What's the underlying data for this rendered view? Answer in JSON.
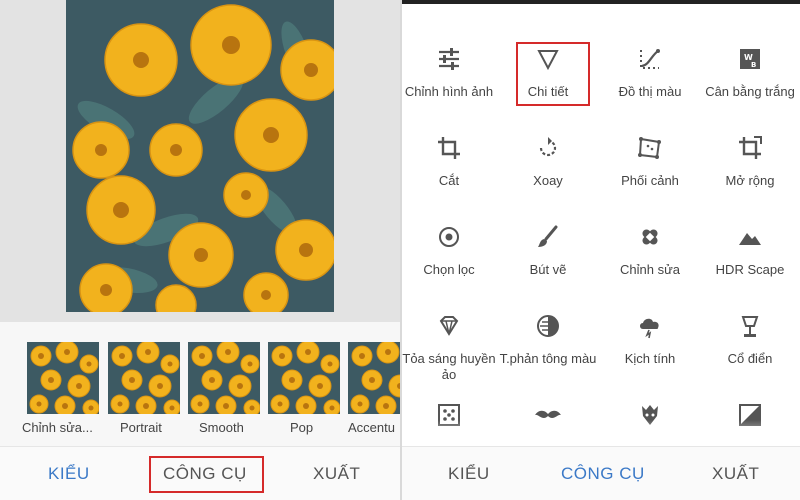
{
  "left_panel": {
    "thumbnails": [
      {
        "label": "Chỉnh sửa..."
      },
      {
        "label": "Portrait"
      },
      {
        "label": "Smooth"
      },
      {
        "label": "Pop"
      },
      {
        "label": "Accentu"
      }
    ],
    "bottom_tabs": {
      "styles": "KIỂU",
      "tools": "CÔNG CỤ",
      "export": "XUẤT"
    }
  },
  "right_panel": {
    "tools": [
      {
        "label": "Chỉnh hình ảnh",
        "icon": "tune-sliders-icon"
      },
      {
        "label": "Chi tiết",
        "icon": "triangle-details-icon"
      },
      {
        "label": "Đồ thị màu",
        "icon": "curves-icon"
      },
      {
        "label": "Cân bằng trắng",
        "icon": "white-balance-icon"
      },
      {
        "label": "Cắt",
        "icon": "crop-icon"
      },
      {
        "label": "Xoay",
        "icon": "rotate-icon"
      },
      {
        "label": "Phối cảnh",
        "icon": "perspective-icon"
      },
      {
        "label": "Mở rộng",
        "icon": "expand-icon"
      },
      {
        "label": "Chọn lọc",
        "icon": "selective-icon"
      },
      {
        "label": "Bút vẽ",
        "icon": "brush-icon"
      },
      {
        "label": "Chỉnh sửa",
        "icon": "healing-icon"
      },
      {
        "label": "HDR Scape",
        "icon": "hdr-mountain-icon"
      },
      {
        "label": "Tỏa sáng huyền ảo",
        "icon": "glamour-glow-icon"
      },
      {
        "label": "T.phản tông màu",
        "icon": "tonal-contrast-icon"
      },
      {
        "label": "Kịch tính",
        "icon": "drama-cloud-icon"
      },
      {
        "label": "Cổ điển",
        "icon": "vintage-lamp-icon"
      },
      {
        "label": "",
        "icon": "grainy-film-icon"
      },
      {
        "label": "",
        "icon": "mustache-icon"
      },
      {
        "label": "",
        "icon": "grunge-icon"
      },
      {
        "label": "",
        "icon": "black-white-icon"
      }
    ],
    "bottom_tabs": {
      "styles": "KIỂU",
      "tools": "CÔNG CỤ",
      "export": "XUẤT"
    }
  },
  "colors": {
    "accent": "#3b79c7",
    "highlight": "#d52a2a",
    "icon": "#555555"
  }
}
